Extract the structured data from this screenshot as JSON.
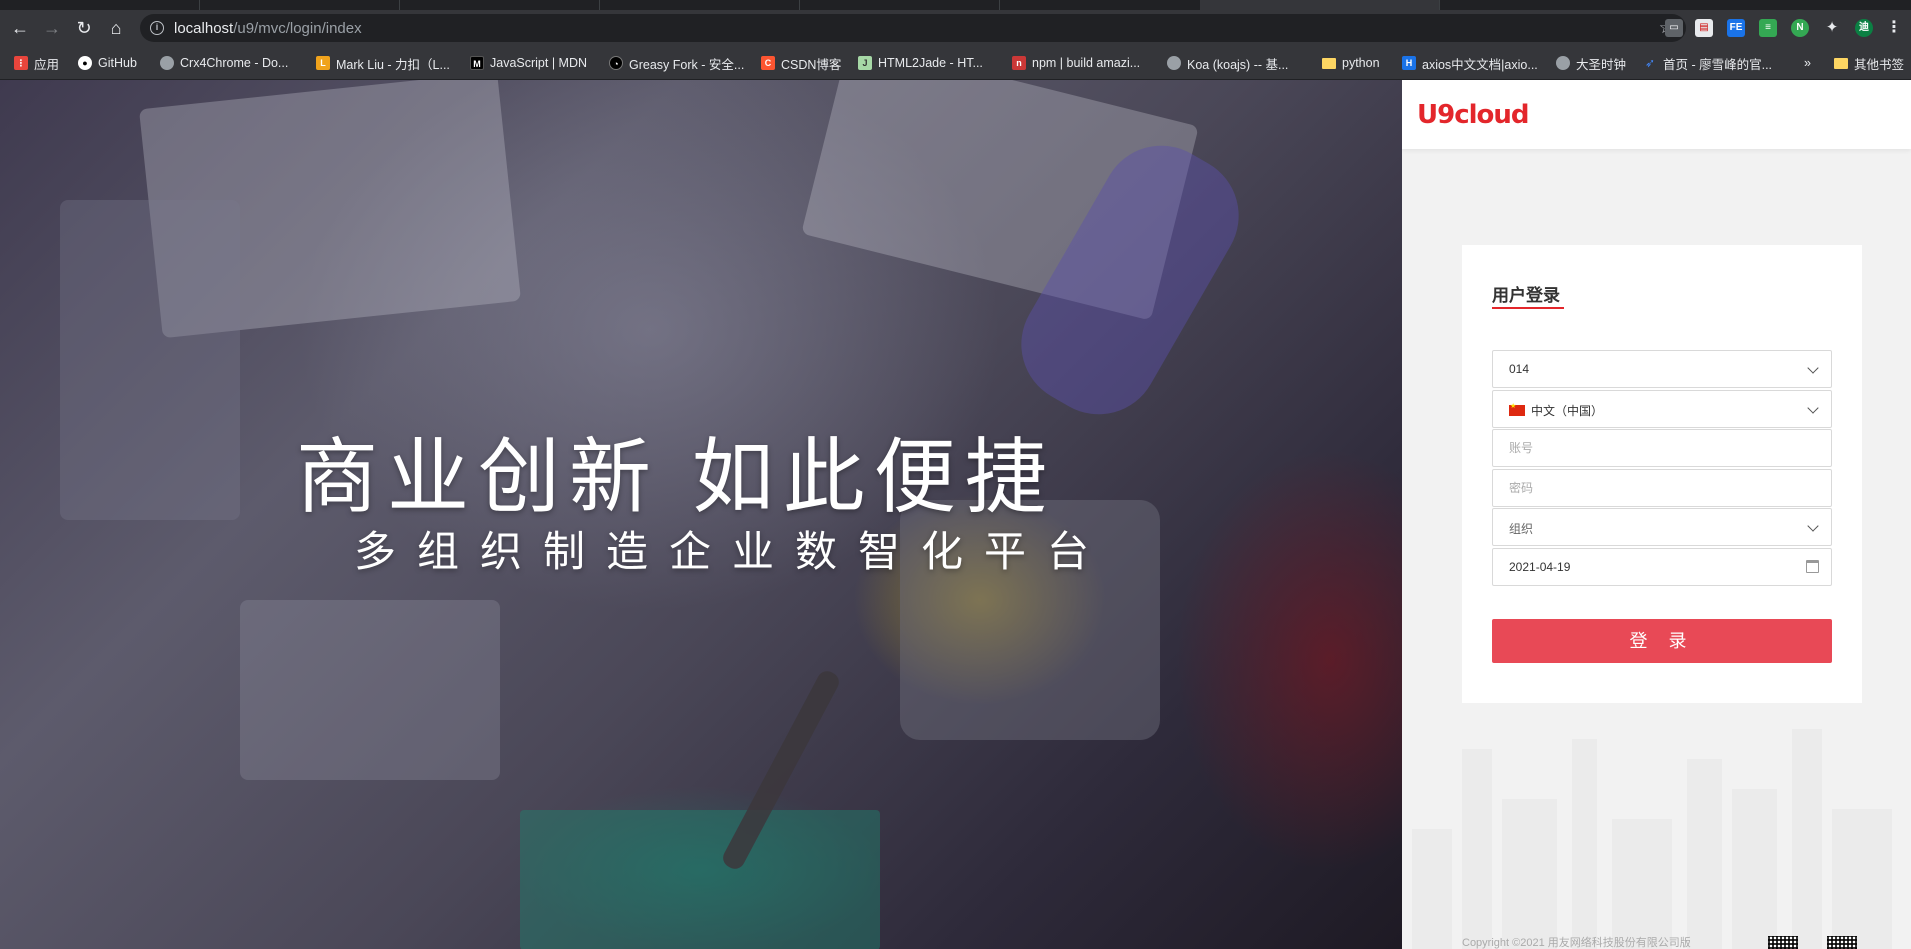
{
  "browser": {
    "url_host": "localhost",
    "url_path": "/u9/mvc/login/index",
    "bookmarks": [
      {
        "label": "应用",
        "icon": "apps-grid-icon",
        "color": "#e8453c"
      },
      {
        "label": "GitHub",
        "icon": "github-icon",
        "color": "#ffffff"
      },
      {
        "label": "Crx4Chrome - Do...",
        "icon": "crx4chrome-icon",
        "color": "#9aa0a6"
      },
      {
        "label": "Mark Liu - 力扣（L...",
        "icon": "leetcode-icon",
        "color": "#f0a31c"
      },
      {
        "label": "JavaScript | MDN",
        "icon": "mdn-icon",
        "color": "#000000"
      },
      {
        "label": "Greasy Fork - 安全...",
        "icon": "greasyfork-icon",
        "color": "#000000"
      },
      {
        "label": "CSDN博客",
        "icon": "csdn-icon",
        "color": "#fc5531"
      },
      {
        "label": "HTML2Jade - HT...",
        "icon": "html2jade-icon",
        "color": "#a6d8a6"
      },
      {
        "label": "npm | build amazi...",
        "icon": "npm-icon",
        "color": "#cb3837"
      },
      {
        "label": "Koa (koajs) -- 基...",
        "icon": "koa-icon",
        "color": "#9aa0a6"
      },
      {
        "label": "python",
        "icon": "folder-icon",
        "color": "#fdd663"
      },
      {
        "label": "axios中文文档|axio...",
        "icon": "axios-icon",
        "color": "#1a73e8"
      },
      {
        "label": "大圣时钟",
        "icon": "clock-icon",
        "color": "#9aa0a6"
      },
      {
        "label": "首页 - 廖雪峰的官...",
        "icon": "liaoxuefeng-icon",
        "color": "#4285f4"
      }
    ],
    "more_label": "»",
    "other_bookmarks": "其他书签"
  },
  "hero": {
    "headline": "商业创新 如此便捷",
    "subline": "多组织制造企业数智化平台"
  },
  "brand": {
    "logo_text": "U9cloud",
    "accent": "#e3262b"
  },
  "login": {
    "title": "用户登录",
    "account_set": "014",
    "language": "中文（中国）",
    "username_placeholder": "账号",
    "password_placeholder": "密码",
    "org_placeholder": "组织",
    "date": "2021-04-19",
    "submit": "登 录",
    "button_color": "#e84956"
  },
  "footer": {
    "copyright": "Copyright ©2021 用友网络科技股份有限公司版"
  }
}
